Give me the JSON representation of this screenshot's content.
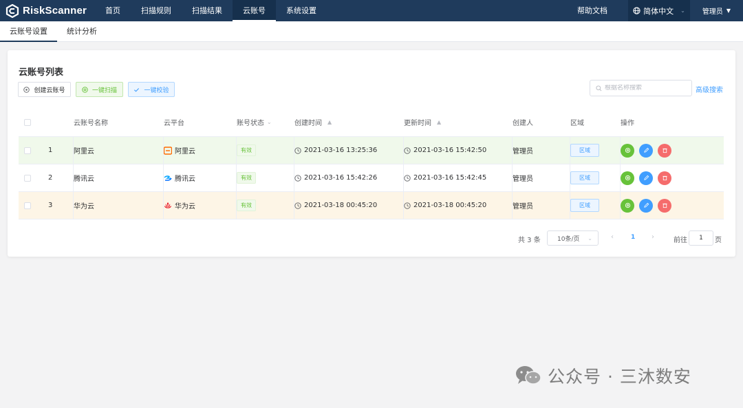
{
  "app": {
    "logo_text": "RiskScanner",
    "brand_color": "#1f3b5c"
  },
  "nav": {
    "items": [
      {
        "label": "首页",
        "active": false
      },
      {
        "label": "扫描规则",
        "active": false
      },
      {
        "label": "扫描结果",
        "active": false
      },
      {
        "label": "云账号",
        "active": true
      },
      {
        "label": "系统设置",
        "active": false
      }
    ],
    "help_label": "帮助文档",
    "language_label": "简体中文",
    "user_label": "管理员"
  },
  "subtabs": [
    {
      "label": "云账号设置",
      "active": true
    },
    {
      "label": "统计分析",
      "active": false
    }
  ],
  "panel": {
    "title": "云账号列表",
    "create_label": "创建云账号",
    "scan_label": "一键扫描",
    "verify_label": "一键校验",
    "search_placeholder": "根据名称搜索",
    "advanced_search_label": "高级搜索"
  },
  "table": {
    "headers": {
      "name": "云账号名称",
      "platform": "云平台",
      "status": "账号状态",
      "created": "创建时间",
      "updated": "更新时间",
      "creator": "创建人",
      "region": "区域",
      "actions": "操作"
    },
    "rows": [
      {
        "index": "1",
        "name": "阿里云",
        "platform": "阿里云",
        "platform_icon": "aliyun-icon",
        "status": "有效",
        "created": "2021-03-16 13:25:36",
        "updated": "2021-03-16 15:42:50",
        "creator": "管理员",
        "region_label": "区域",
        "highlight": "#f0f9eb"
      },
      {
        "index": "2",
        "name": "腾讯云",
        "platform": "腾讯云",
        "platform_icon": "tencent-cloud-icon",
        "status": "有效",
        "created": "2021-03-16 15:42:26",
        "updated": "2021-03-16 15:42:45",
        "creator": "管理员",
        "region_label": "区域",
        "highlight": "#ffffff"
      },
      {
        "index": "3",
        "name": "华为云",
        "platform": "华为云",
        "platform_icon": "huawei-icon",
        "status": "有效",
        "created": "2021-03-18 00:45:20",
        "updated": "2021-03-18 00:45:20",
        "creator": "管理员",
        "region_label": "区域",
        "highlight": "#fdf5e6"
      }
    ]
  },
  "pagination": {
    "total_label": "共 3 条",
    "page_size_label": "10条/页",
    "current_page": "1",
    "goto_label": "前往",
    "goto_value": "1",
    "page_suffix": "页"
  },
  "watermark": {
    "text": "公众号 · 三沐数安"
  }
}
